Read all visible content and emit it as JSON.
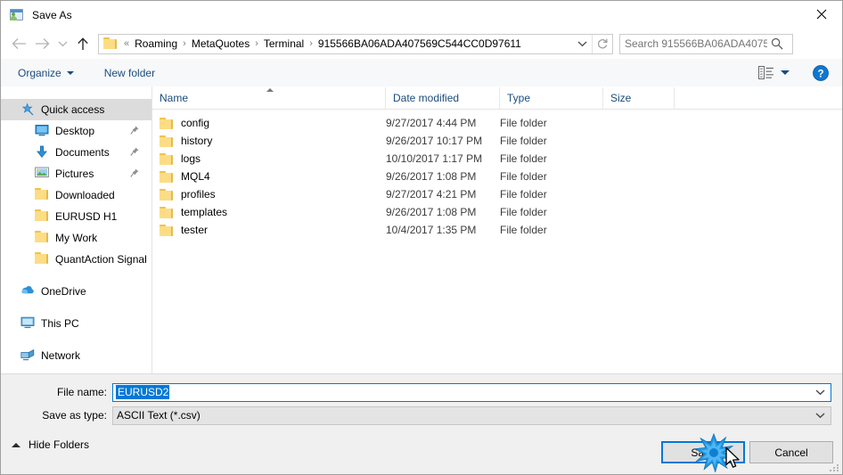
{
  "window": {
    "title": "Save As",
    "icon": "save-as-icon",
    "close_label": "✕"
  },
  "nav": {
    "back_icon": "arrow-left-icon",
    "forward_icon": "arrow-right-icon",
    "recent_icon": "chevron-down-icon",
    "up_icon": "arrow-up-icon",
    "refresh_icon": "refresh-icon",
    "dropdown_icon": "chevron-down-icon"
  },
  "address": {
    "leading": "«",
    "crumbs": [
      "Roaming",
      "MetaQuotes",
      "Terminal",
      "915566BA06ADA407569C544CC0D97611"
    ],
    "separator": "›"
  },
  "search": {
    "placeholder": "Search 915566BA06ADA40756...",
    "icon": "search-icon"
  },
  "toolbar": {
    "organize": "Organize",
    "new_folder": "New folder",
    "view_icon": "list-view-icon",
    "help_label": "?"
  },
  "sidebar": {
    "items": [
      {
        "label": "Quick access",
        "icon": "star-pin-icon",
        "level": "root",
        "selected": true,
        "pinned": false
      },
      {
        "label": "Desktop",
        "icon": "desktop-icon",
        "level": "child",
        "selected": false,
        "pinned": true
      },
      {
        "label": "Documents",
        "icon": "documents-icon",
        "level": "child",
        "selected": false,
        "pinned": true
      },
      {
        "label": "Pictures",
        "icon": "pictures-icon",
        "level": "child",
        "selected": false,
        "pinned": true
      },
      {
        "label": "Downloaded",
        "icon": "folder-icon",
        "level": "child",
        "selected": false,
        "pinned": false
      },
      {
        "label": "EURUSD H1",
        "icon": "folder-icon",
        "level": "child",
        "selected": false,
        "pinned": false
      },
      {
        "label": "My Work",
        "icon": "folder-icon",
        "level": "child",
        "selected": false,
        "pinned": false
      },
      {
        "label": "QuantAction Signal",
        "icon": "folder-icon",
        "level": "child",
        "selected": false,
        "pinned": false
      },
      {
        "label": "OneDrive",
        "icon": "onedrive-icon",
        "level": "root",
        "selected": false,
        "pinned": false,
        "gap": true
      },
      {
        "label": "This PC",
        "icon": "this-pc-icon",
        "level": "root",
        "selected": false,
        "pinned": false,
        "gap": true
      },
      {
        "label": "Network",
        "icon": "network-icon",
        "level": "root",
        "selected": false,
        "pinned": false,
        "gap": true
      }
    ]
  },
  "filelist": {
    "columns": [
      "Name",
      "Date modified",
      "Type",
      "Size"
    ],
    "sort": {
      "column": "Name",
      "direction": "ascending"
    },
    "rows": [
      {
        "name": "config",
        "date": "9/27/2017 4:44 PM",
        "type": "File folder",
        "size": ""
      },
      {
        "name": "history",
        "date": "9/26/2017 10:17 PM",
        "type": "File folder",
        "size": ""
      },
      {
        "name": "logs",
        "date": "10/10/2017 1:17 PM",
        "type": "File folder",
        "size": ""
      },
      {
        "name": "MQL4",
        "date": "9/26/2017 1:08 PM",
        "type": "File folder",
        "size": ""
      },
      {
        "name": "profiles",
        "date": "9/27/2017 4:21 PM",
        "type": "File folder",
        "size": ""
      },
      {
        "name": "templates",
        "date": "9/26/2017 1:08 PM",
        "type": "File folder",
        "size": ""
      },
      {
        "name": "tester",
        "date": "10/4/2017 1:35 PM",
        "type": "File folder",
        "size": ""
      }
    ]
  },
  "form": {
    "file_name_label": "File name:",
    "file_name_value": "EURUSD2",
    "save_as_type_label": "Save as type:",
    "save_as_type_value": "ASCII Text (*.csv)"
  },
  "footer": {
    "hide_folders": "Hide Folders",
    "save": "Save",
    "cancel": "Cancel"
  },
  "colors": {
    "accent": "#0078d7",
    "chrome": "#f0f0f0",
    "link": "#1b4c7d",
    "folder": "#fcdd86"
  }
}
